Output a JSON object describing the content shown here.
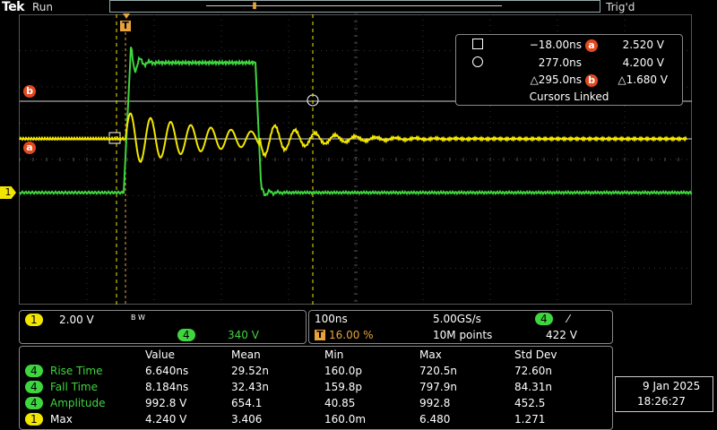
{
  "header": {
    "brand": "Tek",
    "run_state": "Run",
    "trigger_state": "Trig'd"
  },
  "cursors": {
    "cursor1_time": "−18.00ns",
    "cursor1_level": "2.520 V",
    "cursor2_time": "277.0ns",
    "cursor2_level": "4.200 V",
    "delta_time": "△295.0ns",
    "delta_level": "△1.680 V",
    "linked_label": "Cursors Linked",
    "badge_a": "a",
    "badge_b": "b"
  },
  "markers": {
    "trigger": "T",
    "cursor_b": "b",
    "cursor_a": "a",
    "ch1": "1"
  },
  "channels": {
    "ch1_label": "1",
    "ch1_scale": "2.00 V",
    "bw_label": "B W",
    "ch4_label": "4",
    "ch4_scale": "340 V"
  },
  "horizontal": {
    "timebase": "100ns",
    "sample_rate": "5.00GS/s",
    "trigger_source": "4",
    "trigger_slope": "⁄",
    "trigger_pos_icon": "T",
    "trigger_position": "16.00 %",
    "record_length": "10M points",
    "trigger_level": "422 V"
  },
  "measurements": {
    "headers": [
      "Value",
      "Mean",
      "Min",
      "Max",
      "Std Dev"
    ],
    "rows": [
      {
        "ch": "4",
        "name": "Rise Time",
        "value": "6.640ns",
        "mean": "29.52n",
        "min": "160.0p",
        "max": "720.5n",
        "std": "72.60n"
      },
      {
        "ch": "4",
        "name": "Fall Time",
        "value": "8.184ns",
        "mean": "32.43n",
        "min": "159.8p",
        "max": "797.9n",
        "std": "84.31n"
      },
      {
        "ch": "4",
        "name": "Amplitude",
        "value": "992.8 V",
        "mean": "654.1",
        "min": "40.85",
        "max": "992.8",
        "std": "452.5"
      },
      {
        "ch": "1",
        "name": "Max",
        "value": "4.240 V",
        "mean": "3.406",
        "min": "160.0m",
        "max": "6.480",
        "std": "1.271"
      }
    ]
  },
  "datetime": {
    "date": "9 Jan  2025",
    "time": "18:26:27"
  },
  "colors": {
    "ch1": "#f2e600",
    "ch4": "#3ed63e",
    "cursor": "#e2491f",
    "trigger": "#e8a33a"
  }
}
